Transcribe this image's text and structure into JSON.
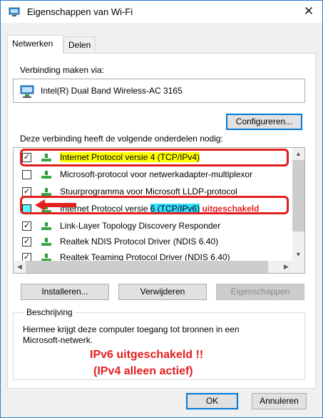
{
  "window": {
    "title": "Eigenschappen van Wi-Fi",
    "close_glyph": "✕"
  },
  "tabs": [
    {
      "label": "Netwerken",
      "active": true
    },
    {
      "label": "Delen",
      "active": false
    }
  ],
  "connection": {
    "label": "Verbinding maken via:",
    "adapter": "Intel(R) Dual Band Wireless-AC 3165",
    "configure_button": "Configureren..."
  },
  "components": {
    "label": "Deze verbinding heeft de volgende onderdelen nodig:",
    "items": [
      {
        "label": "Internet Protocol versie 4 (TCP/IPv4)",
        "checked": true,
        "icon": "network-protocol-icon"
      },
      {
        "label": "Microsoft-protocol voor netwerkadapter-multiplexor",
        "checked": false,
        "icon": "network-protocol-icon"
      },
      {
        "label": "Stuurprogramma voor Microsoft LLDP-protocol",
        "checked": true,
        "icon": "network-protocol-icon"
      },
      {
        "label_prefix": "Internet Protocol versie ",
        "label_highlight": "6 (TCP/IPv6)",
        "annotation": "uitgeschakeld",
        "checked": false,
        "icon": "network-protocol-icon"
      },
      {
        "label": "Link-Layer Topology Discovery Responder",
        "checked": true,
        "icon": "network-protocol-icon"
      },
      {
        "label": "Realtek NDIS Protocol Driver (NDIS 6.40)",
        "checked": true,
        "icon": "network-protocol-icon"
      },
      {
        "label": "Realtek Teaming Protocol Driver (NDIS 6.40)",
        "checked": true,
        "icon": "network-protocol-icon"
      }
    ]
  },
  "buttons": {
    "install": "Installeren...",
    "remove": "Verwijderen",
    "properties": "Eigenschappen",
    "ok": "OK",
    "cancel": "Annuleren"
  },
  "description": {
    "legend": "Beschrijving",
    "text_line1": "Hiermee krijgt deze computer toegang tot bronnen in een",
    "text_line2": "Microsoft-netwerk."
  },
  "annotation": {
    "line1": "IPv6  uitgeschakeld !!",
    "line2": "(IPv4 alleen actief)"
  },
  "colors": {
    "highlight_yellow": "#ffff00",
    "highlight_cyan": "#33e0ff",
    "annotation_red": "#e31e1e"
  }
}
